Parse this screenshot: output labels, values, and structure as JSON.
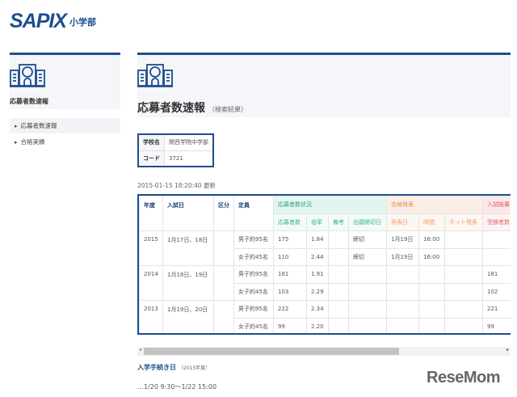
{
  "logo": {
    "brand": "SAPIX",
    "sub": "小学部"
  },
  "sidebar": {
    "title": "応募者数速報",
    "items": [
      {
        "label": "応募者数速報",
        "active": true
      },
      {
        "label": "合格実績",
        "active": false
      }
    ]
  },
  "main": {
    "title": "応募者数速報",
    "subtitle": "（検索結果）"
  },
  "school": {
    "name_label": "学校名",
    "name": "関西学院中学部",
    "code_label": "コード",
    "code": "3721"
  },
  "updated": "2015-01-15 18:20:40 更新",
  "table": {
    "headers": {
      "year": "年度",
      "date": "入試日",
      "div": "区分",
      "cap": "定員",
      "group1": "応募者数状況",
      "group2": "合格発表",
      "group3": "入試結果",
      "sub": [
        "応募者数",
        "倍率",
        "備考",
        "出願締切日",
        "発表日",
        "時間",
        "ネット発表",
        "受験者数"
      ]
    },
    "groups": [
      {
        "year": "2015",
        "date": "1月17日、18日",
        "rows": [
          [
            "男子約95名",
            "175",
            "1.84",
            "",
            "締切",
            "1月19日",
            "16:00",
            "",
            ""
          ],
          [
            "女子約45名",
            "110",
            "2.44",
            "",
            "締切",
            "1月19日",
            "16:00",
            "",
            ""
          ]
        ]
      },
      {
        "year": "2014",
        "date": "1月18日、19日",
        "rows": [
          [
            "男子約95名",
            "181",
            "1.91",
            "",
            "",
            "",
            "",
            "",
            "181"
          ],
          [
            "女子約45名",
            "103",
            "2.29",
            "",
            "",
            "",
            "",
            "",
            "102"
          ]
        ]
      },
      {
        "year": "2013",
        "date": "1月19日、20日",
        "rows": [
          [
            "男子約95名",
            "222",
            "2.34",
            "",
            "",
            "",
            "",
            "",
            "221"
          ],
          [
            "女子約45名",
            "99",
            "2.20",
            "",
            "",
            "",
            "",
            "",
            "99"
          ]
        ]
      }
    ]
  },
  "procedure": {
    "title": "入学手続き日",
    "year": "（2015年度）",
    "period": "…1/20 9:30～1/22 15:00"
  },
  "watermark": "ReseMom"
}
